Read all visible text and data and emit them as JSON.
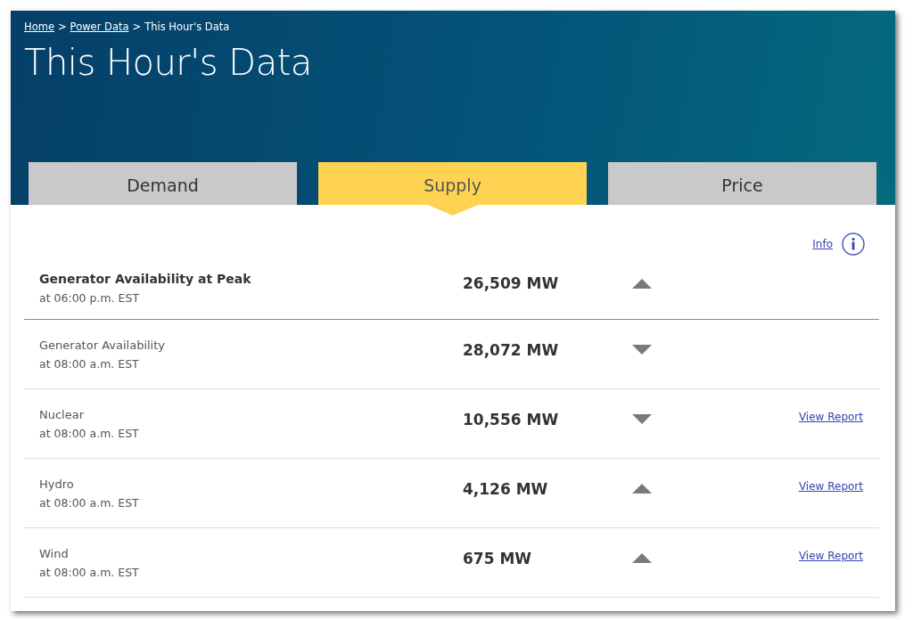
{
  "breadcrumb": [
    {
      "label": "Home",
      "link": true
    },
    {
      "label": "Power Data",
      "link": true
    },
    {
      "label": "This Hour's Data",
      "link": false
    }
  ],
  "breadcrumb_separator": ">",
  "title": "This Hour's Data",
  "tabs": [
    {
      "label": "Demand",
      "selected": false
    },
    {
      "label": "Supply",
      "selected": true
    },
    {
      "label": "Price",
      "selected": false
    }
  ],
  "info_link": "Info",
  "rows": [
    {
      "kind": "peak",
      "name": "Generator Availability at Peak",
      "time": "at 06:00 p.m. EST",
      "value": "26,509 MW",
      "rising": true
    },
    {
      "kind": "source",
      "name": "Generator Availability",
      "time": "at 08:00 a.m. EST",
      "value": "28,072 MW",
      "rising": false
    },
    {
      "kind": "source",
      "name": "Nuclear",
      "time": "at 08:00 a.m. EST",
      "value": "10,556 MW",
      "rising": false,
      "report_link": "View Report"
    },
    {
      "kind": "source",
      "name": "Hydro",
      "time": "at 08:00 a.m. EST",
      "value": "4,126 MW",
      "rising": true,
      "report_link": "View Report"
    },
    {
      "kind": "source",
      "name": "Wind",
      "time": "at 08:00 a.m. EST",
      "value": "675 MW",
      "rising": true,
      "report_link": "View Report"
    }
  ]
}
